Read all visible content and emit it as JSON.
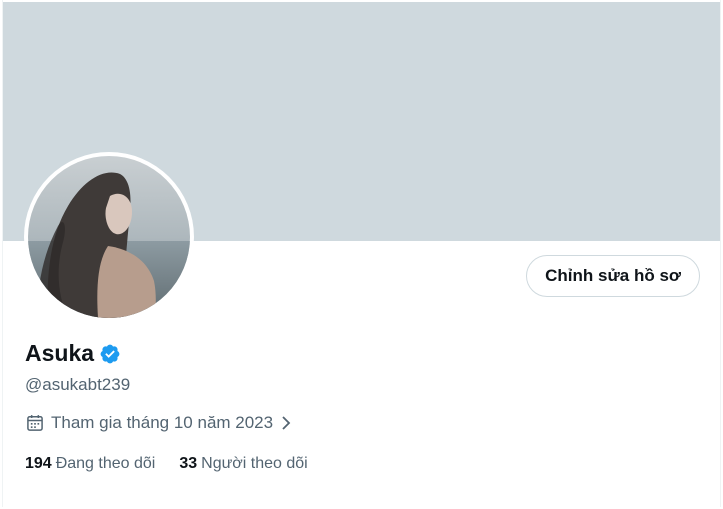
{
  "profile": {
    "display_name": "Asuka",
    "handle": "@asukabt239",
    "joined": "Tham gia tháng 10 năm 2023",
    "edit_button_label": "Chỉnh sửa hồ sơ",
    "following": {
      "count": "194",
      "label": "Đang theo dõi"
    },
    "followers": {
      "count": "33",
      "label": "Người theo dõi"
    }
  },
  "icons": {
    "verified": "verified-badge-icon",
    "calendar": "calendar-icon",
    "chevron": "chevron-right-icon"
  },
  "colors": {
    "banner": "#cfd9de",
    "verified": "#1d9bf0",
    "secondary_text": "#536471",
    "primary_text": "#0f1419"
  }
}
